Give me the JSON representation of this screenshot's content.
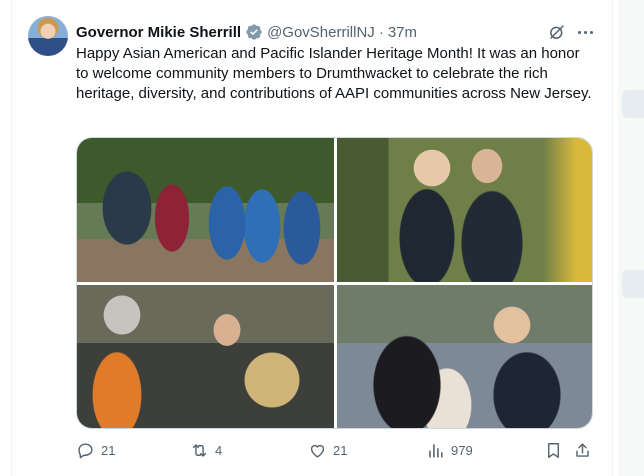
{
  "tweet": {
    "author_name": "Governor Mikie Sherrill",
    "handle": "@GovSherrillNJ",
    "separator": "·",
    "time": "37m",
    "text": "Happy Asian American and Pacific Islander Heritage Month! It was an honor to welcome community members to Drumthwacket to celebrate the rich heritage, diversity, and contributions of AAPI communities across New Jersey.",
    "media_count": 4
  },
  "actions": {
    "replies": "21",
    "reposts": "4",
    "likes": "21",
    "views": "979"
  },
  "colors": {
    "verified_badge": "#829aab",
    "secondary_text": "#536471",
    "primary_text": "#0f1419",
    "border": "#cfd9de"
  },
  "icons": [
    "grok-icon",
    "more-icon",
    "verified-badge-icon",
    "reply-icon",
    "repost-icon",
    "like-icon",
    "views-icon",
    "bookmark-icon",
    "share-icon"
  ]
}
